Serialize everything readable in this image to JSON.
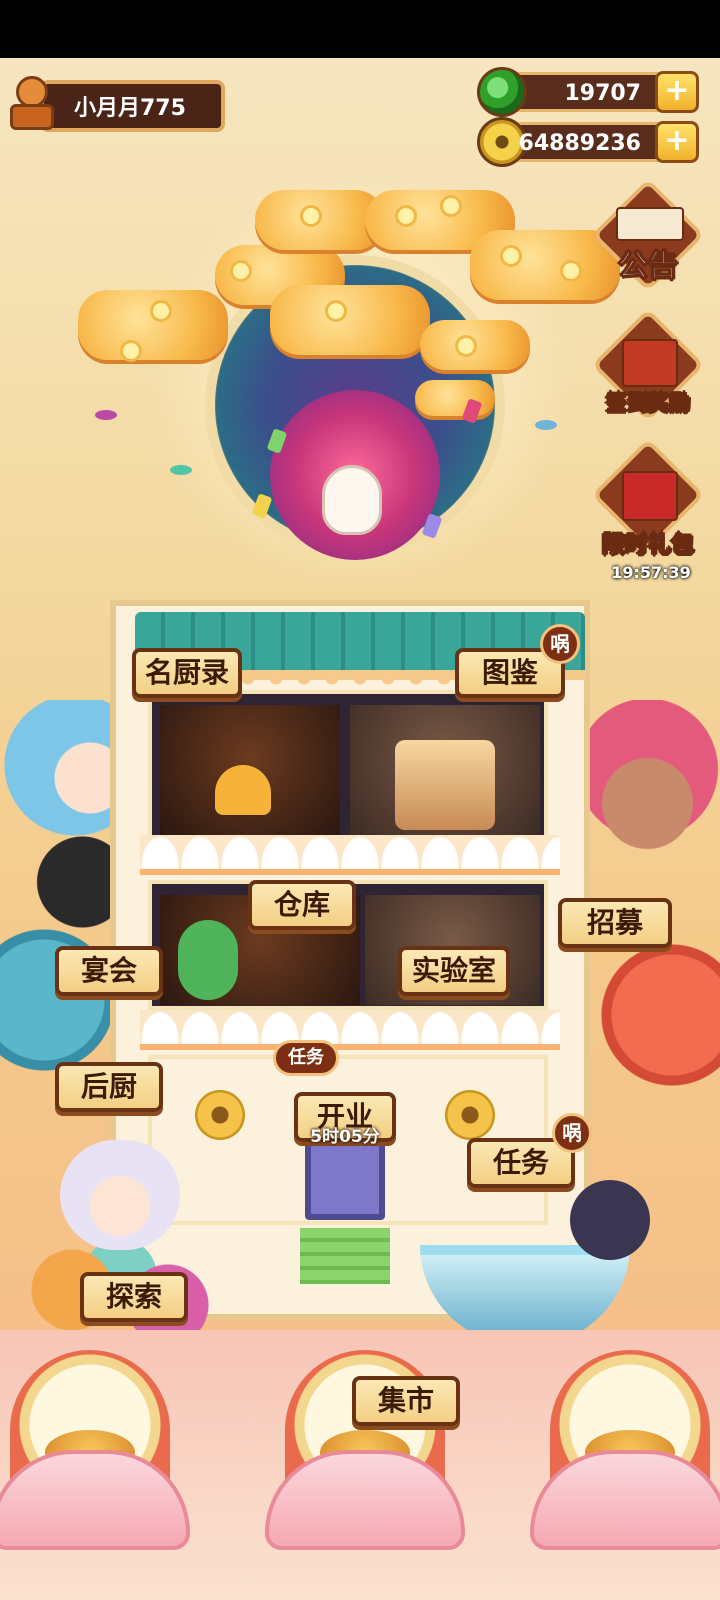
{
  "player": {
    "name": "小月月775"
  },
  "currencies": {
    "jade": {
      "value": "19707",
      "icon": "jade-icon"
    },
    "coins": {
      "value": "64889236",
      "icon": "coin-icon"
    },
    "plus_label": "+"
  },
  "side_menu": {
    "announcement": "公告",
    "checkin": "签到奖励",
    "gift": "限时礼包",
    "gift_timer": "19:57:39"
  },
  "building_labels": {
    "chefs": "名厨录",
    "codex": "图鉴",
    "warehouse": "仓库",
    "recruit": "招募",
    "banquet": "宴会",
    "lab": "实验室",
    "kitchen": "后厨",
    "task_tag": "任务",
    "open": "开业",
    "open_timer": "5时05分",
    "tasks": "任务",
    "explore": "探索",
    "market": "集市",
    "notify_glyph": "㖞"
  },
  "colors": {
    "plaque_bg": "#f3cf84",
    "plaque_border": "#6a3215",
    "currency_bg": "#5a2c1c",
    "plus_btn": "#f2b22c"
  }
}
